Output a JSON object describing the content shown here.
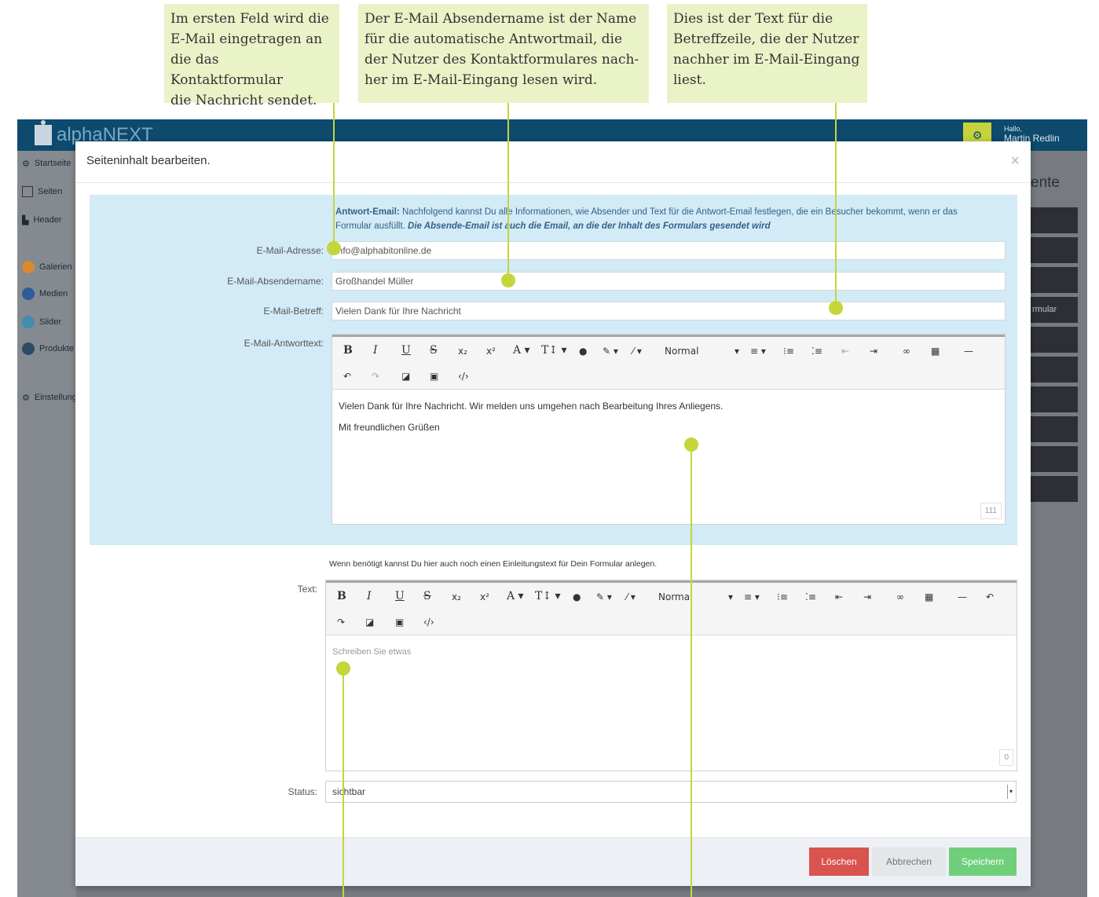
{
  "callouts": [
    {
      "text": "Im ersten Feld wird die\nE-Mail eingetragen an\ndie das Kontaktformular\ndie Nachricht sendet."
    },
    {
      "text": "Der E-Mail Absendername ist der Name\nfür die automatische Antwortmail, die\nder Nutzer des Kontaktformulares nach-\nher im E-Mail-Eingang lesen wird."
    },
    {
      "text": "Dies ist der Text für die\nBetreffzeile, die der Nutzer\nnachher im E-Mail-Eingang\nliest."
    }
  ],
  "app": {
    "logo": "alphaNEXT",
    "greeting": "Hallo,",
    "user": "Martin Redlin",
    "sidebar": [
      "Startseite",
      "Seiten",
      "Header",
      "Galerien",
      "Medien",
      "Slider",
      "Produkte",
      "Einstellungen"
    ],
    "right_panel_title": "ente",
    "right_panel_item": "rmular"
  },
  "modal": {
    "title": "Seiteninhalt bearbeiten.",
    "close": "×",
    "intro_bold": "Antwort-Email:",
    "intro_text": " Nachfolgend kannst Du alle Informationen, wie Absender und Text für die Antwort-Email festlegen, die ein Besucher bekommt, wenn er das Formular ausfüllt. ",
    "intro_emph": "Die Absende-Email ist auch die Email, an die der Inhalt des Formulars gesendet wird",
    "fields": {
      "email_label": "E-Mail-Adresse:",
      "email_value": "info@alphabitonline.de",
      "sender_label": "E-Mail-Absendername:",
      "sender_value": "Großhandel Müller",
      "subject_label": "E-Mail-Betreff:",
      "subject_value": "Vielen Dank für Ihre Nachricht",
      "reply_label": "E-Mail-Antworttext:"
    },
    "editor1": {
      "style_select": "Normal",
      "line1": "Vielen Dank für Ihre Nachricht. Wir melden uns umgehen nach Bearbeitung Ihres Anliegens.",
      "line2": "Mit freundlichen Grüßen",
      "counter": "111"
    },
    "intro2": "Wenn benötigt kannst Du hier auch noch einen Einleitungstext für Dein Formular anlegen.",
    "text_label": "Text:",
    "editor2": {
      "style_select": "Normal",
      "placeholder": "Schreiben Sie etwas",
      "counter": "0"
    },
    "status_label": "Status:",
    "status_value": "sichtbar",
    "buttons": {
      "delete": "Löschen",
      "cancel": "Abbrechen",
      "save": "Speichern"
    }
  },
  "toolbar_glyphs": {
    "bold": "B",
    "italic": "I",
    "underline": "U",
    "strike": "S",
    "sub": "x₂",
    "sup": "x²",
    "font": "A ▾",
    "size": "T↕ ▾",
    "drop": "●",
    "brush": "✎ ▾",
    "wand": "⁄ ▾",
    "align": "≡ ▾",
    "ol": "⁝≡",
    "ul": "⁚≡",
    "outdent": "⇤",
    "indent": "⇥",
    "link": "∞",
    "table": "▦",
    "hr": "—",
    "undo": "↶",
    "redo": "↷",
    "eraser": "◪",
    "image": "▣",
    "code": "‹/›",
    "caret": "▾"
  },
  "colors": {
    "accent": "#c4d63a",
    "header": "#0d4a6d",
    "panel": "#d2ebf6",
    "danger": "#d9534f",
    "success": "#6fcf7a"
  }
}
